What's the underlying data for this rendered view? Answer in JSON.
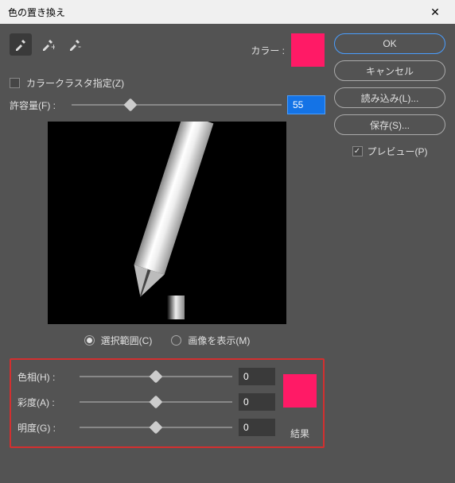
{
  "window": {
    "title": "色の置き換え"
  },
  "controls": {
    "color_cluster_label": "カラークラスタ指定(Z)",
    "color_cluster_checked": false,
    "color_label": "カラー :",
    "color_value": "#ff1a66",
    "tolerance_label": "許容量(F) :",
    "tolerance_value": "55"
  },
  "radios": {
    "selection_label": "選択範囲(C)",
    "image_label": "画像を表示(M)",
    "selected": "selection"
  },
  "result": {
    "hue_label": "色相(H) :",
    "hue_value": "0",
    "sat_label": "彩度(A) :",
    "sat_value": "0",
    "light_label": "明度(G) :",
    "light_value": "0",
    "result_label": "結果",
    "result_color": "#ff1a66"
  },
  "buttons": {
    "ok": "OK",
    "cancel": "キャンセル",
    "load": "読み込み(L)...",
    "save": "保存(S)...",
    "preview_label": "プレビュー(P)",
    "preview_checked": true
  }
}
